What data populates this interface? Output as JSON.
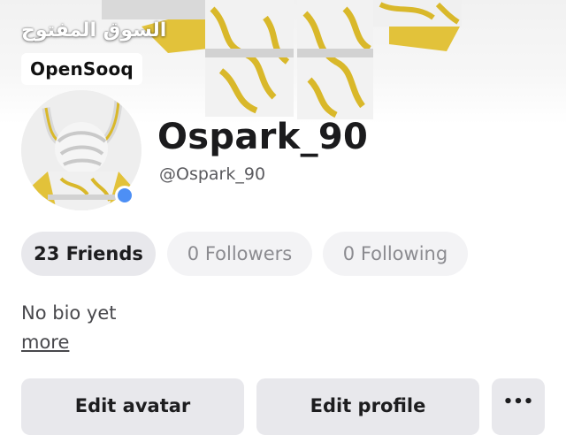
{
  "watermark": {
    "arabic_text": "السوق المفتوح",
    "logo_text": "OpenSooq"
  },
  "profile": {
    "display_name": "Ospark_90",
    "username": "@Ospark_90",
    "online": true,
    "online_color": "#4d8ff5"
  },
  "stats": {
    "friends": "23 Friends",
    "followers": "0 Followers",
    "following": "0 Following"
  },
  "bio": {
    "text": "No bio yet",
    "more_link": "more"
  },
  "actions": {
    "edit_avatar": "Edit avatar",
    "edit_profile": "Edit profile",
    "more_icon": "•••"
  },
  "colors": {
    "gold": "#e2c23a",
    "pill_active": "#e8e8ec",
    "pill_inactive": "#f3f3f5"
  }
}
